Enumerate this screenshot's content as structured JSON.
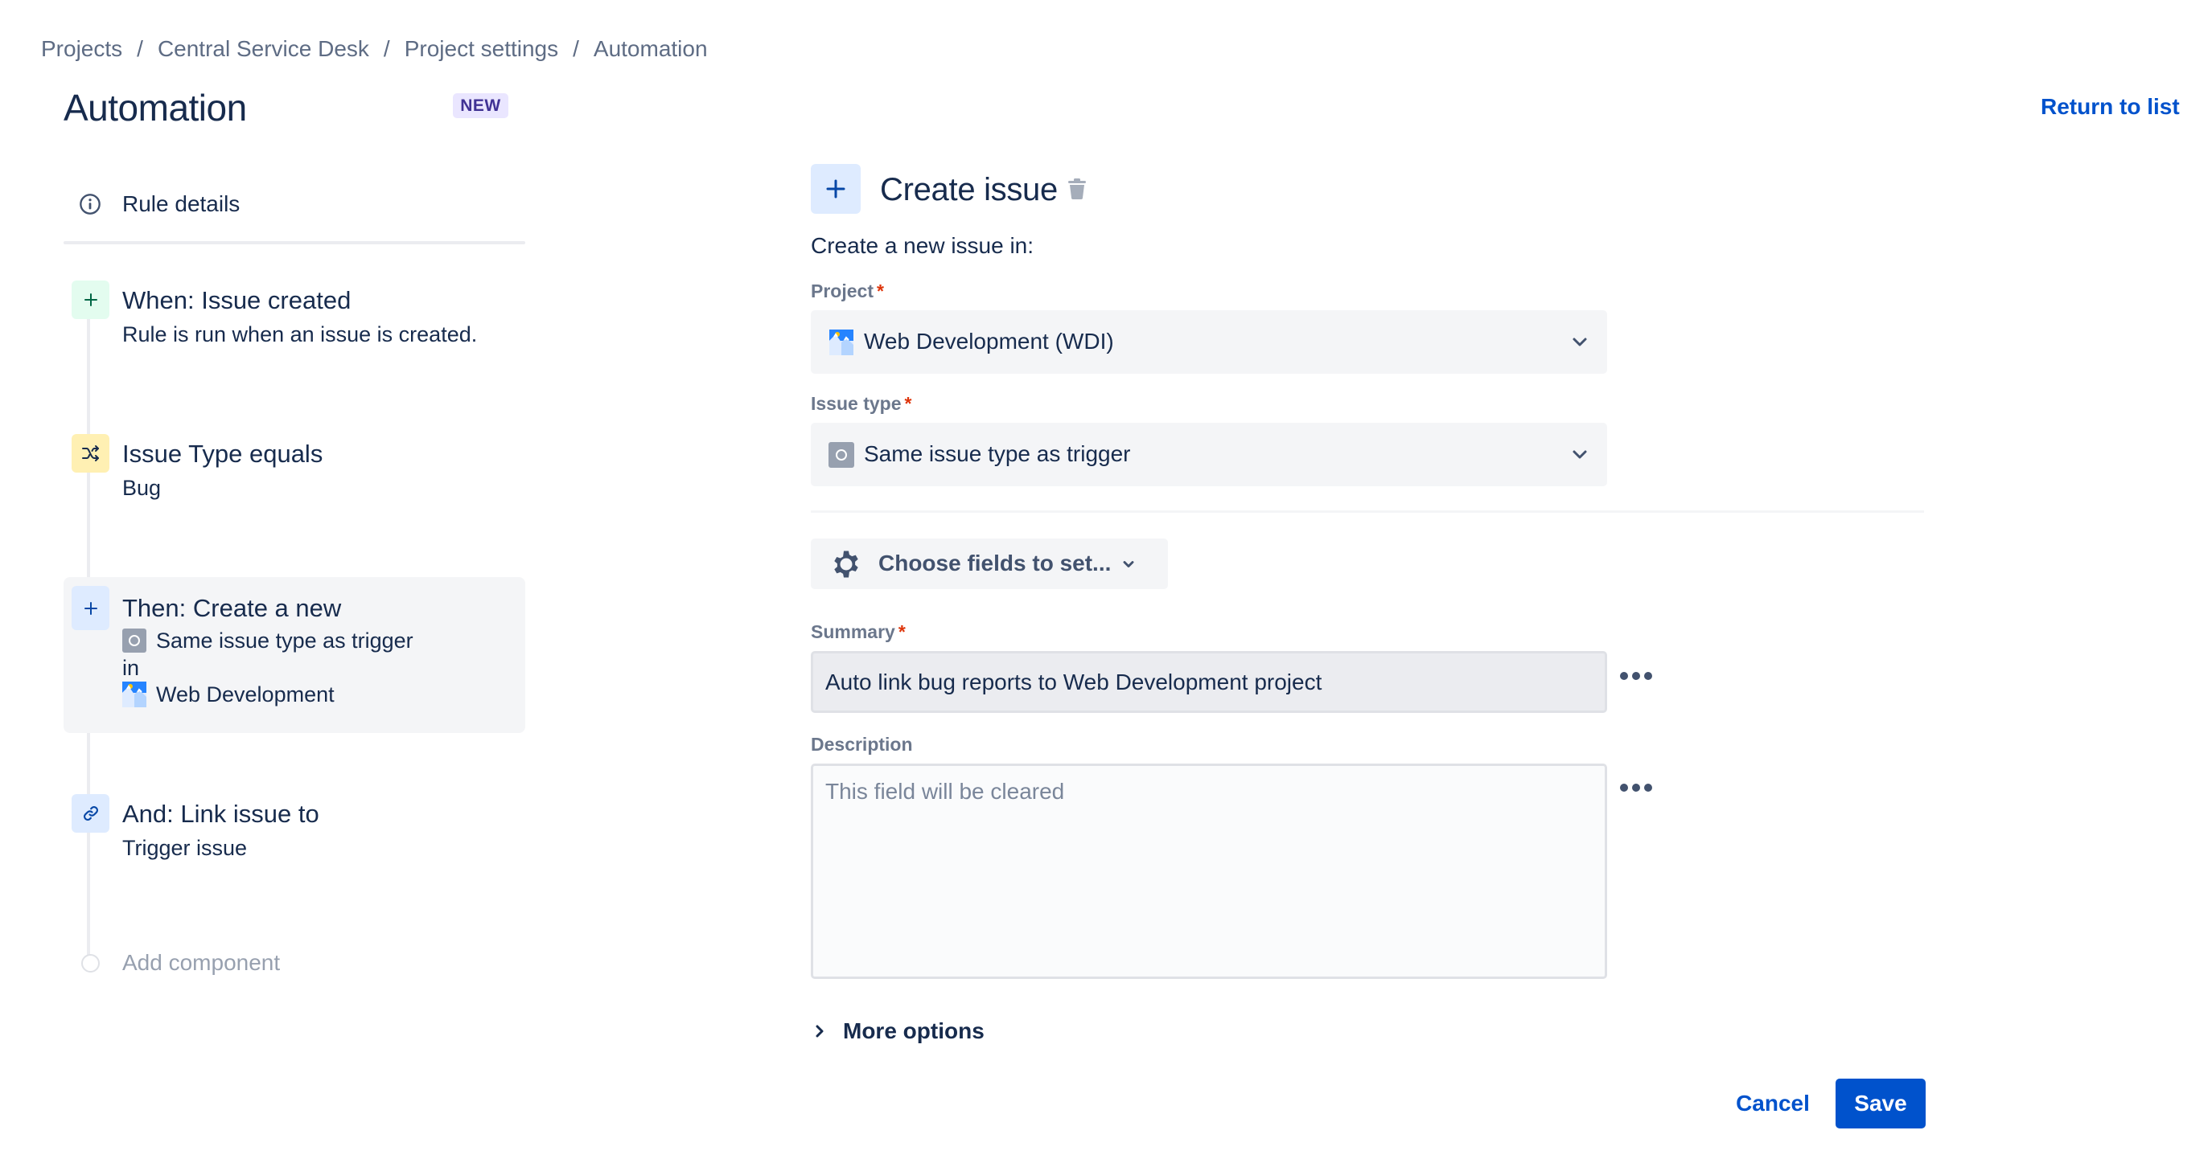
{
  "breadcrumb": [
    "Projects",
    "Central Service Desk",
    "Project settings",
    "Automation"
  ],
  "breadcrumb_separator": "/",
  "header": {
    "title": "Automation",
    "badge": "NEW",
    "return_link": "Return to list"
  },
  "rule_panel": {
    "rule_details_label": "Rule details",
    "steps": [
      {
        "kind": "trigger",
        "icon": "plus-icon",
        "title": "When: Issue created",
        "lines": [
          "Rule is run when an issue is created."
        ],
        "color": "#E3FCEF"
      },
      {
        "kind": "condition",
        "icon": "shuffle-icon",
        "title": "Issue Type equals",
        "lines": [
          "Bug"
        ],
        "color": "#FFF0B3"
      },
      {
        "kind": "action",
        "icon": "plus-icon",
        "title": "Then: Create a new",
        "issue_type": "Same issue type as trigger",
        "connector": "in",
        "project": "Web Development",
        "color": "#DEEBFF",
        "selected": true
      },
      {
        "kind": "action",
        "icon": "link-icon",
        "title": "And: Link issue to",
        "lines": [
          "Trigger issue"
        ],
        "color": "#DEEBFF"
      }
    ],
    "add_component_label": "Add component"
  },
  "config": {
    "title": "Create issue",
    "intro": "Create a new issue in:",
    "project": {
      "label": "Project",
      "required_mark": "*",
      "value": "Web Development (WDI)"
    },
    "issue_type": {
      "label": "Issue type",
      "required_mark": "*",
      "value": "Same issue type as trigger"
    },
    "choose_fields_label": "Choose fields to set...",
    "summary": {
      "label": "Summary",
      "required_mark": "*",
      "value": "Auto link bug reports to Web Development project"
    },
    "description": {
      "label": "Description",
      "placeholder": "This field will be cleared",
      "value": ""
    },
    "more_options_label": "More options",
    "cancel_label": "Cancel",
    "save_label": "Save"
  },
  "colors": {
    "primary": "#0052CC",
    "text": "#172B4D",
    "subtle": "#6B778C",
    "required": "#DE350B",
    "badge_bg": "#EAE6FF",
    "badge_text": "#403294"
  }
}
